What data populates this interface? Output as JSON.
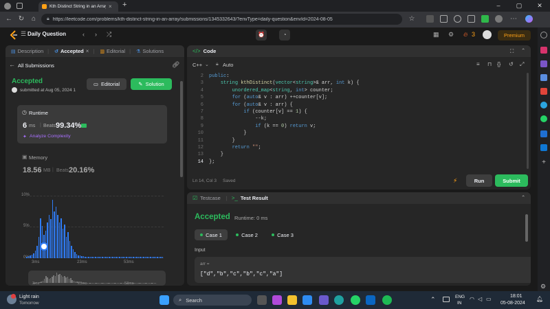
{
  "browser": {
    "tab_title": "Kth Distinct String in an Array - L",
    "url": "https://leetcode.com/problems/kth-distinct-string-in-an-array/submissions/1345332643/?envType=daily-question&envId=2024-08-05"
  },
  "nav": {
    "title": "Daily Question",
    "streak": "3",
    "premium": "Premium"
  },
  "left": {
    "tabs": [
      "Description",
      "Accepted",
      "Editorial",
      "Solutions"
    ],
    "back": "All Submissions",
    "status": "Accepted",
    "submitted": "submitted at Aug 05, 2024 1",
    "editorial_btn": "Editorial",
    "solution_btn": "Solution",
    "runtime_label": "Runtime",
    "runtime_value": "6",
    "runtime_unit": "ms",
    "beats_label": "Beats",
    "runtime_beats": "99.34%",
    "analyze": "Analyze Complexity",
    "memory_label": "Memory",
    "memory_value": "18.56",
    "memory_unit": "MB",
    "memory_beats": "20.16%",
    "y_ticks": [
      "10%",
      "5%",
      "0%"
    ],
    "x_ticks": [
      "3ms",
      "23ms",
      "53ms"
    ],
    "mini_x_ticks": [
      "3ms",
      "23ms",
      "53ms"
    ]
  },
  "chart_data": {
    "type": "bar",
    "title": "",
    "xlabel": "",
    "ylabel": "",
    "ylim": [
      0,
      10
    ],
    "x_ticks": [
      "3ms",
      "23ms",
      "53ms"
    ],
    "values": [
      0.2,
      0.3,
      0.4,
      0.6,
      0.8,
      1.2,
      2.0,
      3.5,
      6.5,
      5.2,
      3.8,
      4.5,
      5.8,
      7.0,
      6.3,
      9.4,
      7.6,
      8.3,
      7.0,
      5.8,
      6.5,
      4.8,
      5.5,
      3.5,
      4.2,
      2.8,
      2.0,
      1.4,
      1.0,
      0.7,
      0.5,
      0.4,
      0.3,
      0.3,
      0.2,
      0.2,
      0.2,
      0.2,
      0.2,
      0.2,
      0.2,
      0.2,
      0.2,
      0.2,
      0.2,
      0.2,
      0.2,
      0.2,
      0.2,
      0.2,
      0.2,
      0.2,
      0.2,
      0.2,
      0.2,
      0.2,
      0.2,
      0.2,
      0.2,
      0.2,
      0.2,
      0.2,
      0.2,
      0.2,
      0.2,
      0.2,
      0.2,
      0.2,
      0.2,
      0.2,
      0.2,
      0.2,
      0.2,
      0.2,
      0.2,
      0.2,
      0.2,
      0.2,
      0.2,
      0.2
    ],
    "bar_color": "#2f7cf7"
  },
  "code": {
    "title": "Code",
    "language": "C++",
    "mode": "Auto",
    "status": "Ln 14, Col 3",
    "saved": "Saved",
    "run": "Run",
    "submit": "Submit",
    "lines": [
      {
        "n": "2",
        "text": "public:"
      },
      {
        "n": "3",
        "text": "    string kthDistinct(vector<string>& arr, int k) {"
      },
      {
        "n": "4",
        "text": "        unordered_map<string, int> counter;"
      },
      {
        "n": "5",
        "text": "        for (auto& v : arr) ++counter[v];"
      },
      {
        "n": "6",
        "text": "        for (auto& v : arr) {"
      },
      {
        "n": "7",
        "text": "            if (counter[v] == 1) {"
      },
      {
        "n": "8",
        "text": "                --k;"
      },
      {
        "n": "9",
        "text": "                if (k == 0) return v;"
      },
      {
        "n": "10",
        "text": "            }"
      },
      {
        "n": "11",
        "text": "        }"
      },
      {
        "n": "12",
        "text": "        return \"\";"
      },
      {
        "n": "13",
        "text": "    }"
      },
      {
        "n": "14",
        "text": "};"
      }
    ]
  },
  "result": {
    "tabs": [
      "Testcase",
      "Test Result"
    ],
    "status": "Accepted",
    "runtime": "Runtime: 0 ms",
    "cases": [
      "Case 1",
      "Case 2",
      "Case 3"
    ],
    "input_label": "Input",
    "arr_label": "arr =",
    "arr_value": "[\"d\",\"b\",\"c\",\"b\",\"c\",\"a\"]"
  },
  "taskbar": {
    "weather": "Light rain",
    "weather_sub": "Tomorrow",
    "search": "Search",
    "lang": "ENG",
    "lang_sub": "IN",
    "time": "18:01",
    "date": "05-08-2024"
  }
}
